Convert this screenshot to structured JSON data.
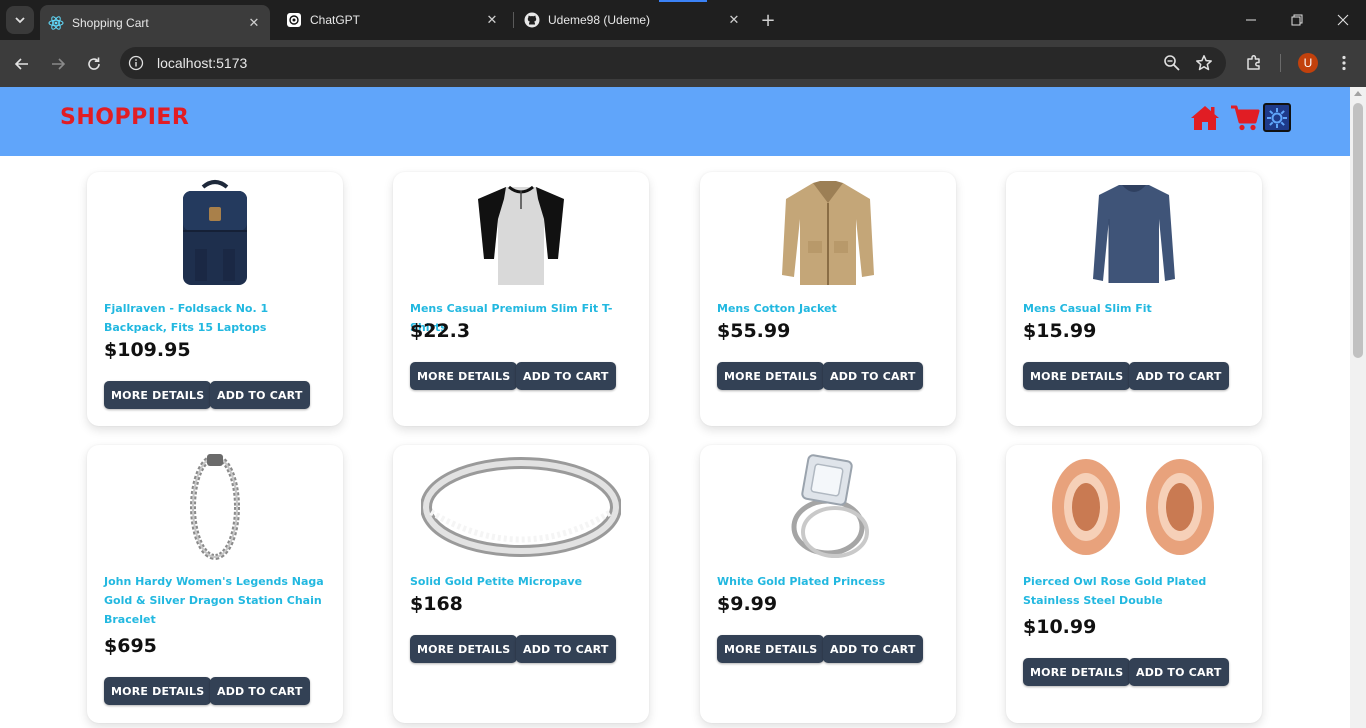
{
  "browser": {
    "tabs": [
      {
        "title": "Shopping Cart",
        "favicon": "react-icon",
        "active": true
      },
      {
        "title": "ChatGPT",
        "favicon": "chatgpt-icon",
        "active": false
      },
      {
        "title": "Udeme98 (Udeme)",
        "favicon": "github-icon",
        "active": false
      }
    ],
    "url": "localhost:5173",
    "profile_initial": "U",
    "profile_color": "#c2410c"
  },
  "site": {
    "logo": "SHOPPIER",
    "logo_color": "#e11d24",
    "header_color": "#60a5fa",
    "nav_icons": [
      "home-icon",
      "cart-icon",
      "theme-toggle-icon"
    ]
  },
  "products": [
    {
      "name": "Fjallraven - Foldsack No. 1 Backpack, Fits 15 Laptops",
      "price": "$109.95",
      "image": "backpack"
    },
    {
      "name": "Mens Casual Premium Slim Fit T-Shirts",
      "price": "$22.3",
      "image": "raglan-tshirt"
    },
    {
      "name": "Mens Cotton Jacket",
      "price": "$55.99",
      "image": "cotton-jacket"
    },
    {
      "name": "Mens Casual Slim Fit",
      "price": "$15.99",
      "image": "long-sleeve-shirt"
    },
    {
      "name": "John Hardy Women's Legends Naga Gold & Silver Dragon Station Chain Bracelet",
      "price": "$695",
      "image": "dragon-bracelet"
    },
    {
      "name": "Solid Gold Petite Micropave",
      "price": "$168",
      "image": "micropave-ring"
    },
    {
      "name": "White Gold Plated Princess",
      "price": "$9.99",
      "image": "princess-ring"
    },
    {
      "name": "Pierced Owl Rose Gold Plated Stainless Steel Double",
      "price": "$10.99",
      "image": "rose-gold-tunnels"
    }
  ],
  "buttons": {
    "more_details": "MORE DETAILS",
    "add_to_cart": "ADD TO CART"
  },
  "colors": {
    "product_name": "#22b8e0",
    "button_bg": "#334155"
  }
}
